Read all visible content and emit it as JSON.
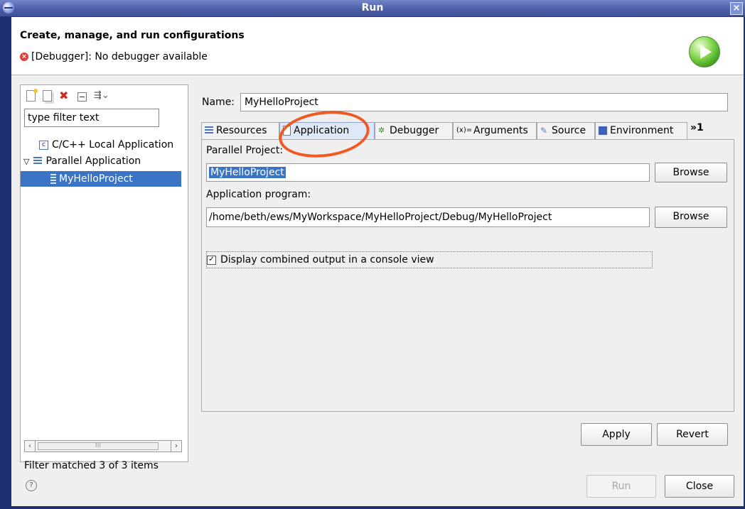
{
  "window": {
    "title": "Run"
  },
  "header": {
    "title": "Create, manage, and run configurations",
    "error_message": "[Debugger]: No debugger available"
  },
  "left_panel": {
    "filter_placeholder": "type filter text",
    "tree": [
      {
        "label": "C/C++ Local Application"
      },
      {
        "label": "Parallel Application"
      },
      {
        "label": "MyHelloProject",
        "selected": true
      }
    ],
    "status": "Filter matched 3 of 3 items",
    "scrollbar_thumb_label": "III"
  },
  "config": {
    "name_label": "Name:",
    "name_value": "MyHelloProject",
    "tabs": [
      "Resources",
      "Application",
      "Debugger",
      "Arguments",
      "Source",
      "Environment"
    ],
    "active_tab": "Application",
    "more_tabs_label": "»1",
    "parallel_project_label": "Parallel Project:",
    "parallel_project_value": "MyHelloProject",
    "app_program_label": "Application program:",
    "app_program_value": "/home/beth/ews/MyWorkspace/MyHelloProject/Debug/MyHelloProject",
    "browse_label": "Browse",
    "checkbox_label": "Display combined output in a console view",
    "checkbox_checked": true
  },
  "buttons": {
    "apply": "Apply",
    "revert": "Revert",
    "run": "Run",
    "close": "Close"
  },
  "icons": {
    "tab_icons": [
      "resources-icon",
      "application-icon",
      "debugger-icon",
      "arguments-icon",
      "source-icon",
      "environment-icon"
    ]
  },
  "colors": {
    "selection": "#3b74c4",
    "annotation": "#f05a22",
    "titlebar": "#4c5fa9"
  }
}
